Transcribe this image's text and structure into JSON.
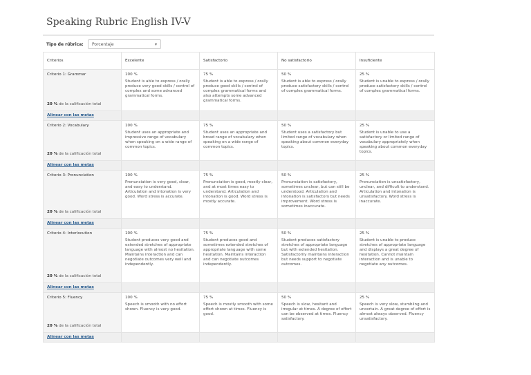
{
  "title": "Speaking Rubric English IV-V",
  "rubric_type": {
    "label": "Tipo de rúbrica:",
    "value": "Porcentaje"
  },
  "headers": [
    "Criterios",
    "Excelente",
    "Satisfactorio",
    "No satisfactorio",
    "Insuficiente"
  ],
  "align_label": "Alinear con las metas",
  "weight_suffix": "de la calificación total",
  "criteria": [
    {
      "name": "Criterio 1: Grammar",
      "weight": "20 %",
      "row_height": 60,
      "levels": [
        {
          "pct": "100 %",
          "desc": "Student is able to express / orally produce very good skills / control of complex and some advanced grammatical forms."
        },
        {
          "pct": "75 %",
          "desc": "Student is able to express / orally produce good skills / control of complex grammatical forms and also attempts some advanced grammatical forms."
        },
        {
          "pct": "50 %",
          "desc": "Student is able to express / orally produce satisfactory skills / control of complex grammatical forms."
        },
        {
          "pct": "25 %",
          "desc": "Student is unable to express / orally produce satisfactory skills / control of complex grammatical forms."
        }
      ]
    },
    {
      "name": "Criterio 2: Vocabulary",
      "weight": "20 %",
      "row_height": 58,
      "levels": [
        {
          "pct": "100 %",
          "desc": "Student uses an appropriate and impressive range of vocabulary when speaking on a wide range of common topics."
        },
        {
          "pct": "75 %",
          "desc": "Student uses an appropriate and broad range of vocabulary when speaking on a wide range of common topics."
        },
        {
          "pct": "50 %",
          "desc": "Student uses a satisfactory but limited range of vocabulary when speaking about common everyday topics."
        },
        {
          "pct": "25 %",
          "desc": "Student is unable to use a satisfactory or limited range of vocabulary appropriately when speaking about common everyday topics."
        }
      ]
    },
    {
      "name": "Criterio 3: Pronunciation",
      "weight": "20 %",
      "row_height": 70,
      "levels": [
        {
          "pct": "100 %",
          "desc": "Pronunciation is very good, clear, and easy to understand. Articulation and intonation is very good. Word stress is accurate."
        },
        {
          "pct": "75 %",
          "desc": "Pronunciation is good, mostly clear, and at most times easy to understand. Articulation and intonation is good. Word stress is mostly accurate."
        },
        {
          "pct": "50 %",
          "desc": "Pronunciation is satisfactory, sometimes unclear, but can still be understood. Articulation and intonation is satisfactory but needs improvement. Word stress is sometimes inaccurate."
        },
        {
          "pct": "25 %",
          "desc": "Pronunciation is unsatisfactory, unclear, and difficult to understand. Articulation and intonation is unsatisfactory. Word stress is inaccurate."
        }
      ]
    },
    {
      "name": "Criterio 4: Interlocution",
      "weight": "20 %",
      "row_height": 79,
      "levels": [
        {
          "pct": "100 %",
          "desc": "Student produces very good and extended stretches of appropriate language with almost no hesitation. Maintains interaction and can negotiate outcomes very well and independently."
        },
        {
          "pct": "75 %",
          "desc": "Student produces good and sometimes extended stretches of appropriate language with some hesitation. Maintains interaction and can negotiate outcomes independently."
        },
        {
          "pct": "50 %",
          "desc": "Student produces satisfactory stretches of appropriate language but with extended hesitation. Satisfactorily maintains interaction but needs support to negotiate outcomes."
        },
        {
          "pct": "25 %",
          "desc": "Student is unable to produce stretches of appropriate language and displays a great degree of hesitation. Cannot maintain interaction and is unable to negotiate any outcomes."
        }
      ]
    },
    {
      "name": "Criterio 5: Fluency",
      "weight": "20 %",
      "row_height": 58,
      "levels": [
        {
          "pct": "100 %",
          "desc": "Speech is smooth with no effort shown. Fluency is very good."
        },
        {
          "pct": "75 %",
          "desc": "Speech is mostly smooth with some effort shown at times. Fluency is good."
        },
        {
          "pct": "50 %",
          "desc": "Speech is slow, hesitant and irregular at times. A degree of effort can be observed at times. Fluency satisfactory."
        },
        {
          "pct": "25 %",
          "desc": "Speech is very slow, stumbling and uncertain. A great degree of effort is almost always observed. Fluency unsatisfactory."
        }
      ]
    }
  ]
}
